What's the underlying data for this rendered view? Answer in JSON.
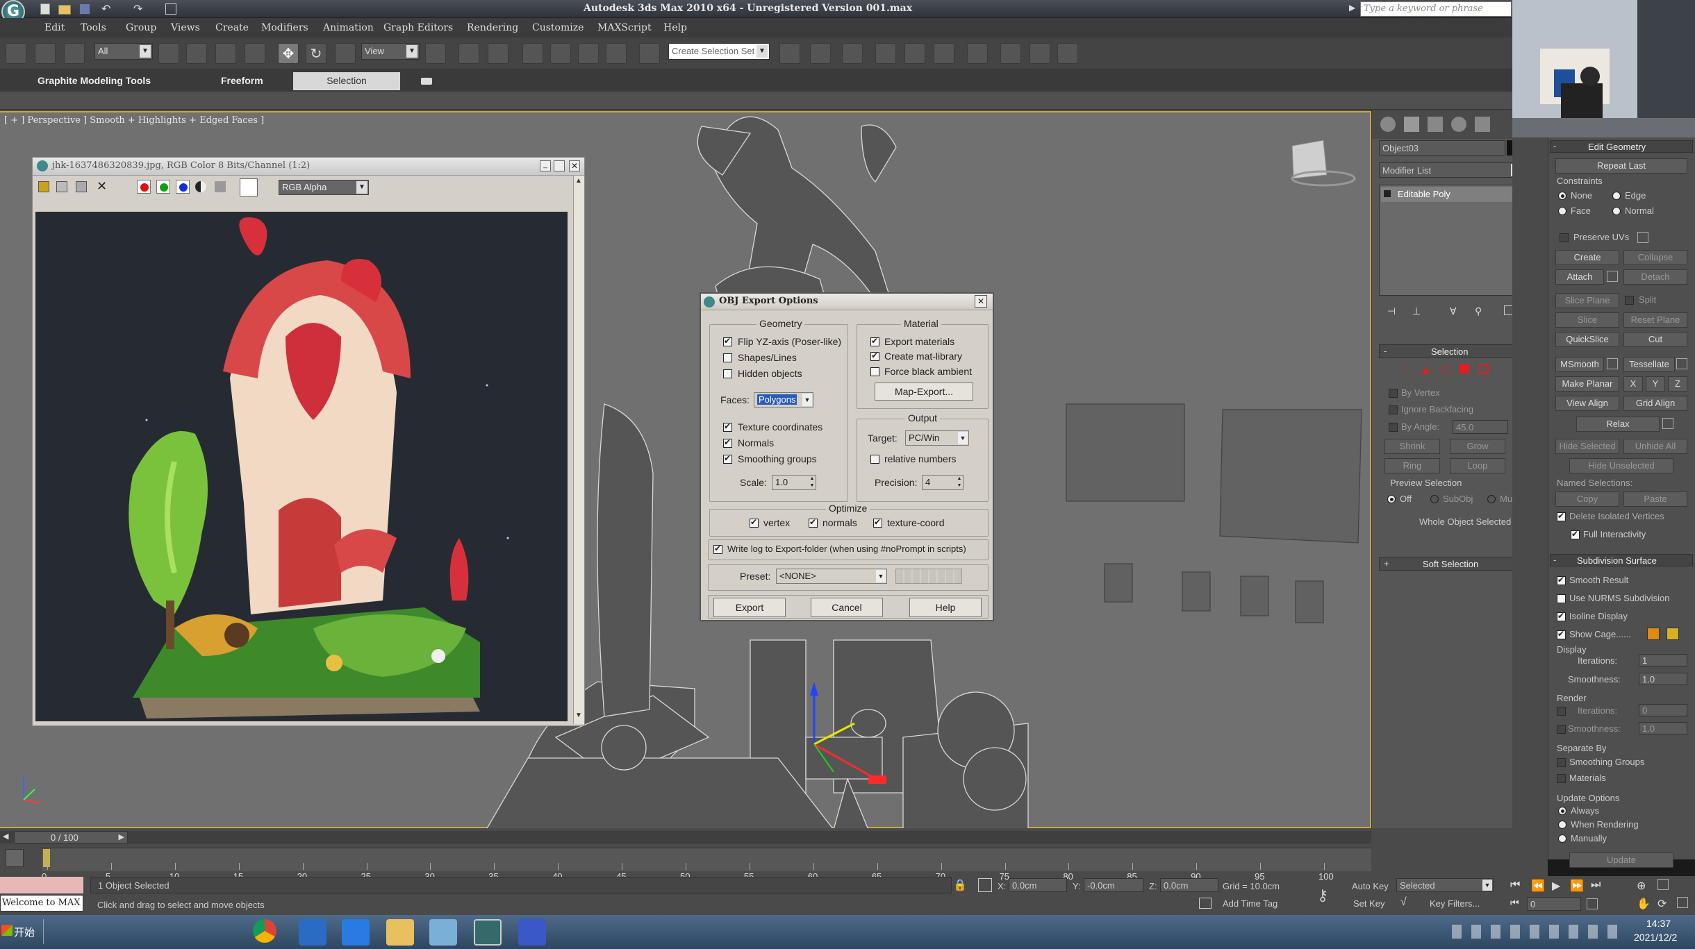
{
  "titlebar": {
    "title": "Autodesk 3ds Max  2010 x64  - Unregistered Version  001.max",
    "search_placeholder": "Type a keyword or phrase"
  },
  "menu": [
    "Edit",
    "Tools",
    "Group",
    "Views",
    "Create",
    "Modifiers",
    "Animation",
    "Graph Editors",
    "Rendering",
    "Customize",
    "MAXScript",
    "Help"
  ],
  "toolbar": {
    "filter_value": "All",
    "refcoord_value": "View",
    "selection_set_value": "Create Selection Set"
  },
  "ribbon": {
    "tabs": [
      "Graphite Modeling Tools",
      "Freeform",
      "Selection"
    ]
  },
  "viewport": {
    "label": "[ + ] Perspective ] Smooth + Highlights + Edged Faces ]"
  },
  "render_window": {
    "title": "jhk-1637486320839.jpg, RGB Color 8 Bits/Channel (1:2)",
    "channel_value": "RGB Alpha"
  },
  "dialog": {
    "title": "OBJ Export Options",
    "geometry_label": "Geometry",
    "flip_yz": "Flip YZ-axis (Poser-like)",
    "flip_yz_checked": true,
    "shapes_lines": "Shapes/Lines",
    "shapes_checked": false,
    "hidden_objects": "Hidden objects",
    "hidden_checked": false,
    "faces_label": "Faces:",
    "faces_value": "Polygons",
    "texture_coords": "Texture coordinates",
    "texture_checked": true,
    "normals": "Normals",
    "normals_checked": true,
    "smoothing_groups": "Smoothing groups",
    "smoothing_checked": true,
    "scale_label": "Scale:",
    "scale_value": "1.0",
    "material_label": "Material",
    "export_materials": "Export materials",
    "export_materials_checked": true,
    "create_mat_library": "Create mat-library",
    "create_mat_checked": true,
    "force_black": "Force black ambient",
    "force_black_checked": false,
    "map_export": "Map-Export...",
    "output_label": "Output",
    "target_label": "Target:",
    "target_value": "PC/Win",
    "relative_numbers": "relative numbers",
    "relative_checked": false,
    "precision_label": "Precision:",
    "precision_value": "4",
    "optimize_label": "Optimize",
    "opt_vertex": "vertex",
    "opt_normals": "normals",
    "opt_texcoord": "texture-coord",
    "write_log": "Write log to Export-folder (when using #noPrompt in scripts)",
    "write_log_checked": true,
    "preset_label": "Preset:",
    "preset_value": "<NONE>",
    "export_button": "Export",
    "cancel_button": "Cancel",
    "help_button": "Help"
  },
  "command_panel": {
    "object_name": "Object03",
    "modifier_list": "Modifier List",
    "stack_item": "Editable Poly",
    "selection_title": "Selection",
    "by_vertex": "By Vertex",
    "ignore_backfacing": "Ignore Backfacing",
    "by_angle": "By Angle:",
    "by_angle_value": "45.0",
    "shrink": "Shrink",
    "grow": "Grow",
    "ring": "Ring",
    "loop": "Loop",
    "preview_selection": "Preview Selection",
    "prev_off": "Off",
    "prev_subobj": "SubObj",
    "prev_multi": "Multi",
    "whole_object": "Whole Object Selected",
    "soft_selection": "Soft Selection"
  },
  "edit_geometry": {
    "title": "Edit Geometry",
    "repeat_last": "Repeat Last",
    "constraints": "Constraints",
    "c_none": "None",
    "c_edge": "Edge",
    "c_face": "Face",
    "c_normal": "Normal",
    "preserve_uvs": "Preserve UVs",
    "create": "Create",
    "collapse": "Collapse",
    "attach": "Attach",
    "detach": "Detach",
    "slice_plane": "Slice Plane",
    "split": "Split",
    "slice": "Slice",
    "reset_plane": "Reset Plane",
    "quickslice": "QuickSlice",
    "cut": "Cut",
    "msmooth": "MSmooth",
    "tessellate": "Tessellate",
    "make_planar": "Make Planar",
    "x": "X",
    "y": "Y",
    "z": "Z",
    "view_align": "View Align",
    "grid_align": "Grid Align",
    "relax": "Relax",
    "hide_selected": "Hide Selected",
    "unhide_all": "Unhide All",
    "hide_unselected": "Hide Unselected",
    "named_selections": "Named Selections:",
    "copy": "Copy",
    "paste": "Paste",
    "delete_isolated": "Delete Isolated Vertices",
    "full_interactivity": "Full Interactivity",
    "subdiv_title": "Subdivision Surface",
    "smooth_result": "Smooth Result",
    "use_nurms": "Use NURMS Subdivision",
    "isoline": "Isoline Display",
    "show_cage": "Show Cage......",
    "display": "Display",
    "iterations": "Iterations:",
    "iter_value": "1",
    "smoothness": "Smoothness:",
    "smooth_value": "1.0",
    "render": "Render",
    "r_iter_value": "0",
    "r_smooth_value": "1.0",
    "separate_by": "Separate By",
    "smoothing_groups": "Smoothing Groups",
    "materials": "Materials",
    "update_options": "Update Options",
    "always": "Always",
    "when_rendering": "When Rendering",
    "manually": "Manually",
    "update": "Update"
  },
  "timeline": {
    "frame": "0 / 100",
    "ticks": [
      "0",
      "5",
      "10",
      "15",
      "20",
      "25",
      "30",
      "35",
      "40",
      "45",
      "50",
      "55",
      "60",
      "65",
      "70",
      "75",
      "80",
      "85",
      "90",
      "95",
      "100"
    ]
  },
  "status": {
    "selected": "1 Object Selected",
    "prompt": "Click and drag to select and move objects",
    "maxscript": "Welcome to MAX",
    "x_label": "X:",
    "x_value": "0.0cm",
    "y_label": "Y:",
    "y_value": "-0.0cm",
    "z_label": "Z:",
    "z_value": "0.0cm",
    "grid": "Grid = 10.0cm",
    "add_time_tag": "Add Time Tag",
    "auto_key": "Auto Key",
    "set_key": "Set Key",
    "selected_dropdown": "Selected",
    "key_filters": "Key Filters...",
    "frame_field": "0"
  },
  "taskbar": {
    "start": "开始",
    "time": "14:37",
    "date": "2021/12/2"
  },
  "colors": {
    "viewport_border": "#c9a83a",
    "dialog_bg": "#d4d0c8",
    "selection_red": "#e02020"
  }
}
